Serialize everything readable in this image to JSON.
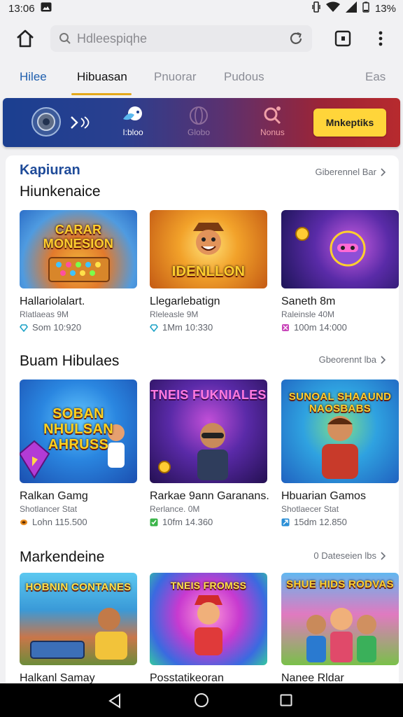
{
  "status": {
    "time": "13:06",
    "battery": "13%"
  },
  "urlbar": {
    "url": "Hdleespiqhe"
  },
  "tabs": [
    {
      "label": "Hilee"
    },
    {
      "label": "Hibuasan"
    },
    {
      "label": "Pnuorar"
    },
    {
      "label": "Pudous"
    },
    {
      "label": "Eas"
    }
  ],
  "banner": {
    "items": [
      {
        "label": "",
        "icon": "speaker-icon"
      },
      {
        "label": "",
        "icon": "chevron-right-icon"
      },
      {
        "label": "I:bloo",
        "icon": "bird-icon"
      },
      {
        "label": "Globo",
        "icon": "globe-icon"
      },
      {
        "label": "Nonus",
        "icon": "search-icon"
      }
    ],
    "cta": "Mnkeptiks"
  },
  "sections": [
    {
      "kicker": "Kapiuran",
      "title": "Hiunkenaice",
      "see_all": "Giberennel Bar",
      "cards": [
        {
          "caption": "CARAR MONESION",
          "title": "Hallariolalart.",
          "sub": "Rlatlaeas 9M",
          "meta": "Som 10:920",
          "meta_icon": "diamond-icon",
          "badge": "",
          "palette": "a"
        },
        {
          "caption": "IDENLLON",
          "title": "Llegarlebatign",
          "sub": "Rleleasle 9M",
          "meta": "1Mm 10:330",
          "meta_icon": "diamond-icon",
          "badge": "",
          "palette": "b"
        },
        {
          "caption": "",
          "title": "Saneth 8m",
          "sub": "Raleinsle 40M",
          "meta": "100m 14:000",
          "meta_icon": "grid-icon",
          "badge": "",
          "palette": "c"
        }
      ]
    },
    {
      "kicker": "",
      "title": "Buam Hibulaes",
      "see_all": "Gbeorennt lba",
      "cards": [
        {
          "caption": "SOBAN NHULSAN AHRUSS",
          "title": "Ralkan Gamg",
          "sub": "Shotlancer Stat",
          "meta": "Lohn 115.500",
          "meta_icon": "coin-icon",
          "badge": "",
          "palette": "d"
        },
        {
          "caption": "TNEIS FUKNIALES",
          "title": "Rarkae 9ann Garanans.",
          "sub": "Rerlance. 0M",
          "meta": "10fm 14.360",
          "meta_icon": "check-icon",
          "badge": "",
          "palette": "e"
        },
        {
          "caption": "SUNOAL SHAAUND NAOSBABS",
          "title": "Hbuarian Gamos",
          "sub": "Shotlaecer Stat",
          "meta": "15dm 12.850",
          "meta_icon": "arrow-icon",
          "badge": "",
          "palette": "f"
        }
      ]
    },
    {
      "kicker": "",
      "title": "Markendeine",
      "see_all": "0 Dateseien lbs",
      "cards": [
        {
          "caption": "HOBNIN CONTANES",
          "title": "Halkanl Samay",
          "sub": "",
          "meta": "",
          "meta_icon": "",
          "badge": "",
          "palette": "g"
        },
        {
          "caption": "TNEIS FROMSS",
          "title": "Posstatikeoran",
          "sub": "",
          "meta": "",
          "meta_icon": "",
          "badge": "",
          "palette": "h"
        },
        {
          "caption": "SHUE HIDS RODVAS",
          "title": "Nanee Rldar",
          "sub": "",
          "meta": "",
          "meta_icon": "",
          "badge": "",
          "palette": "i"
        }
      ]
    }
  ],
  "colors": {
    "accent": "#e5a91b",
    "link_blue": "#1f5fae",
    "cta": "#ffd53a"
  }
}
